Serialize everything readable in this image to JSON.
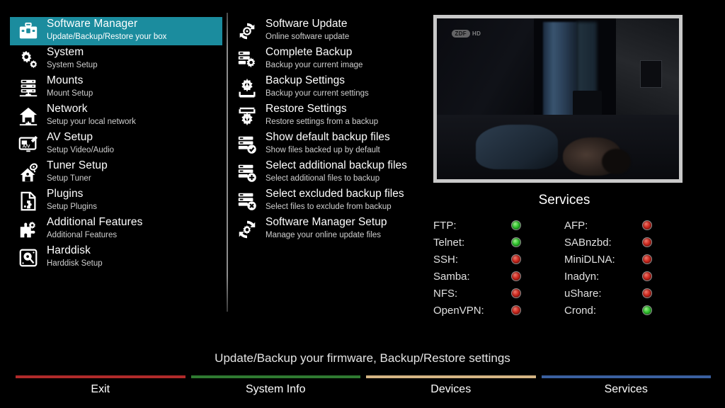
{
  "sidebar": {
    "items": [
      {
        "title": "Software Manager",
        "sub": "Update/Backup/Restore your box",
        "icon": "toolbox-icon",
        "selected": true
      },
      {
        "title": "System",
        "sub": "System Setup",
        "icon": "gears-icon",
        "selected": false
      },
      {
        "title": "Mounts",
        "sub": "Mount Setup",
        "icon": "server-icon",
        "selected": false
      },
      {
        "title": "Network",
        "sub": "Setup your local network",
        "icon": "house-icon",
        "selected": false
      },
      {
        "title": "AV Setup",
        "sub": "Setup Video/Audio",
        "icon": "av-screen-icon",
        "selected": false
      },
      {
        "title": "Tuner Setup",
        "sub": "Setup Tuner",
        "icon": "satellite-house-icon",
        "selected": false
      },
      {
        "title": "Plugins",
        "sub": "Setup Plugins",
        "icon": "puzzle-page-icon",
        "selected": false
      },
      {
        "title": "Additional Features",
        "sub": "Additional Features",
        "icon": "puzzle-gears-icon",
        "selected": false
      },
      {
        "title": "Harddisk",
        "sub": "Harddisk Setup",
        "icon": "harddisk-icon",
        "selected": false
      }
    ]
  },
  "center": {
    "items": [
      {
        "title": "Software Update",
        "sub": "Online software update",
        "icon": "sync-arrows-icon"
      },
      {
        "title": "Complete Backup",
        "sub": "Backup your current image",
        "icon": "server-gear-icon"
      },
      {
        "title": "Backup Settings",
        "sub": "Backup your current settings",
        "icon": "gear-download-icon"
      },
      {
        "title": "Restore Settings",
        "sub": "Restore settings from a backup",
        "icon": "gear-upload-icon"
      },
      {
        "title": "Show default backup files",
        "sub": "Show files backed up by default",
        "icon": "server-check-icon"
      },
      {
        "title": "Select additional backup files",
        "sub": "Select additional files to backup",
        "icon": "server-plus-icon"
      },
      {
        "title": "Select excluded backup files",
        "sub": "Select files to exclude from backup",
        "icon": "server-cross-icon"
      },
      {
        "title": "Software Manager Setup",
        "sub": "Manage your online update files",
        "icon": "sync-gear-icon"
      }
    ]
  },
  "video": {
    "channel_badge": "ZDF",
    "channel_hd": "HD"
  },
  "services": {
    "title": "Services",
    "left": [
      {
        "label": "FTP:",
        "state": "on"
      },
      {
        "label": "Telnet:",
        "state": "on"
      },
      {
        "label": "SSH:",
        "state": "off"
      },
      {
        "label": "Samba:",
        "state": "off"
      },
      {
        "label": "NFS:",
        "state": "off"
      },
      {
        "label": "OpenVPN:",
        "state": "off"
      }
    ],
    "right": [
      {
        "label": "AFP:",
        "state": "off"
      },
      {
        "label": "SABnzbd:",
        "state": "off"
      },
      {
        "label": "MiniDLNA:",
        "state": "off"
      },
      {
        "label": "Inadyn:",
        "state": "off"
      },
      {
        "label": "uShare:",
        "state": "off"
      },
      {
        "label": "Crond:",
        "state": "on"
      }
    ]
  },
  "footer": {
    "status": "Update/Backup your firmware, Backup/Restore settings",
    "buttons": [
      {
        "label": "Exit",
        "color": "#b02a2a"
      },
      {
        "label": "System Info",
        "color": "#2f7a31"
      },
      {
        "label": "Devices",
        "color": "#d4b483"
      },
      {
        "label": "Services",
        "color": "#3a5f9f"
      }
    ]
  },
  "colors": {
    "accent": "#1b8c9e",
    "led_on": "#34c832",
    "led_off": "#d12a20"
  }
}
